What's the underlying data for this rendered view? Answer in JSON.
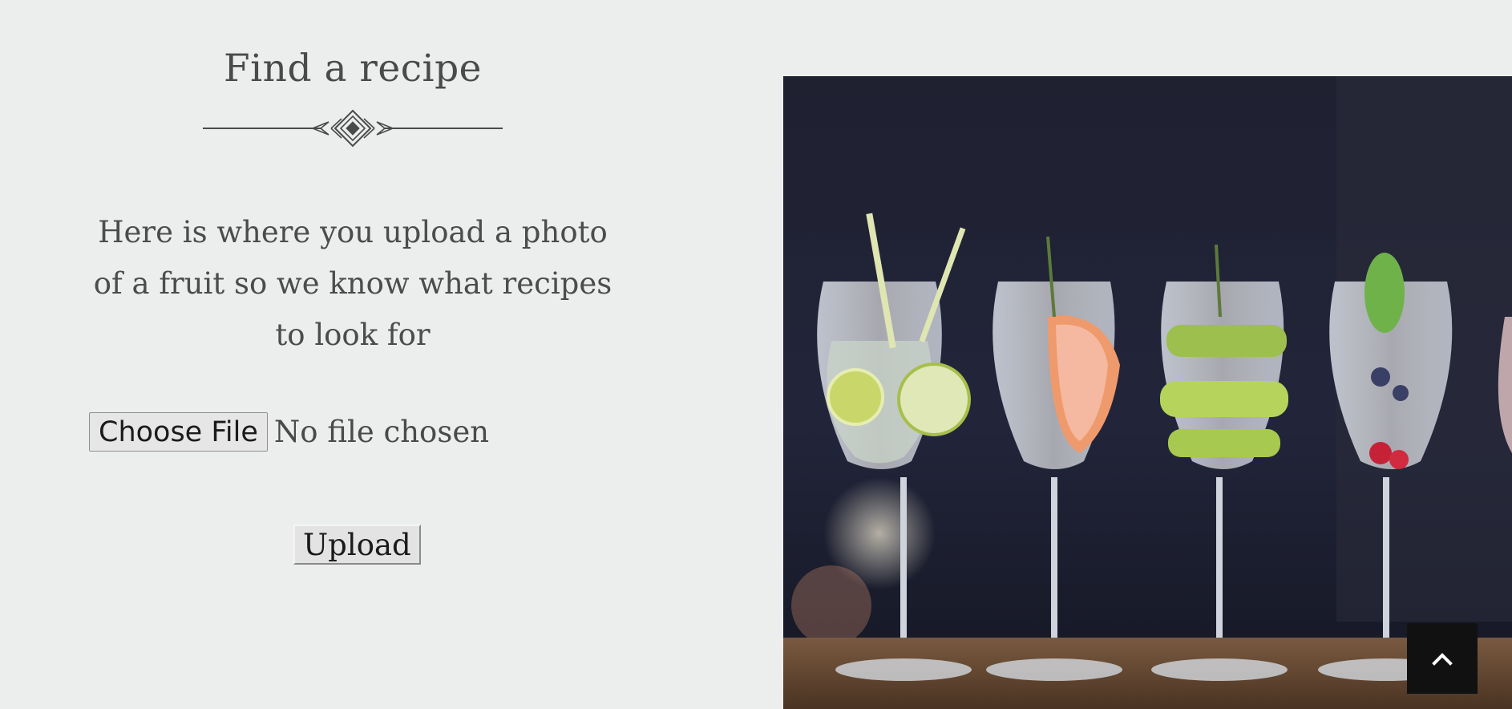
{
  "header": {
    "title": "Find a recipe"
  },
  "main": {
    "description": "Here is where you upload a photo of a fruit so we know what recipes to look for",
    "file_input": {
      "button_label": "Choose File",
      "status_text": "No file chosen"
    },
    "upload_label": "Upload"
  },
  "icons": {
    "divider": "ornamental-divider-icon",
    "scroll_top": "chevron-up-icon"
  },
  "colors": {
    "background": "#eceeed",
    "text": "#4a4a4a",
    "scroll_button": "#111111"
  }
}
